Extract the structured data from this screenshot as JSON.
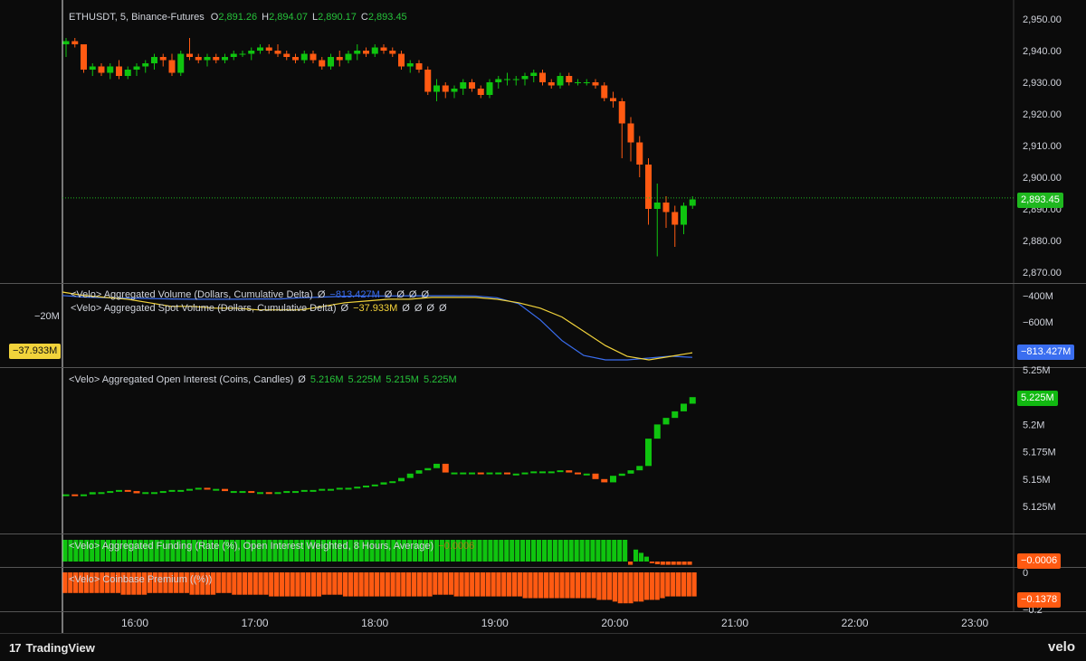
{
  "header": {
    "symbol": "ETHUSDT, 5, Binance-Futures",
    "o_label": "O",
    "o_value": "2,891.26",
    "h_label": "H",
    "h_value": "2,894.07",
    "l_label": "L",
    "l_value": "2,890.17",
    "c_label": "C",
    "c_value": "2,893.45"
  },
  "price_pane": {
    "ticks": [
      "2,950.00",
      "2,940.00",
      "2,930.00",
      "2,920.00",
      "2,910.00",
      "2,900.00",
      "2,890.00",
      "2,880.00",
      "2,870.00"
    ],
    "last_price_label": "2,893.45",
    "last_price": 2893.45
  },
  "volume_pane": {
    "legend1_name": "<Velo> Aggregated Volume (Dollars, Cumulative Delta)",
    "legend1_values": [
      "Ø",
      "−813.427M",
      "Ø",
      "Ø",
      "Ø",
      "Ø"
    ],
    "legend2_name": "<Velo> Aggregated Spot Volume (Dollars, Cumulative Delta)",
    "legend2_values": [
      "Ø",
      "−37.933M",
      "Ø",
      "Ø",
      "Ø",
      "Ø"
    ],
    "right_ticks": [
      "−400M",
      "−600M"
    ],
    "left_tick": "−20M",
    "left_tag": "−37.933M",
    "right_tag": "−813.427M"
  },
  "oi_pane": {
    "legend_name": "<Velo> Aggregated Open Interest (Coins, Candles)",
    "legend_values": [
      "Ø",
      "5.216M",
      "5.225M",
      "5.215M",
      "5.225M"
    ],
    "ticks": [
      "5.25M",
      "5.2M",
      "5.175M",
      "5.15M",
      "5.125M"
    ],
    "last_tag": "5.225M"
  },
  "funding_pane": {
    "legend_name": "<Velo> Aggregated Funding (Rate (%), Open Interest Weighted, 8 Hours, Average)",
    "legend_value": "−0.0006",
    "last_tag": "−0.0006"
  },
  "premium_pane": {
    "legend_name": "<Velo> Coinbase Premium ((%))",
    "ticks": [
      "0",
      "−0.2"
    ],
    "last_tag": "−0.1378"
  },
  "time_axis": [
    "16:00",
    "17:00",
    "18:00",
    "19:00",
    "20:00",
    "21:00",
    "22:00",
    "23:00"
  ],
  "footer": {
    "brand": "TradingView",
    "velo": "velo"
  },
  "colors": {
    "up": "#0fc40f",
    "down": "#ff5a12",
    "spot": "#f2d33b",
    "perp": "#3a6ef0",
    "bg": "#0b0b0b",
    "grid": "#2a2a2a",
    "last_price_tag": "#1fb81f"
  },
  "chart_data": [
    {
      "type": "candlestick",
      "title": "ETHUSDT, 5, Binance-Futures",
      "x": "5-minute candles from about 15:30 to 20:40",
      "ylim": [
        2865,
        2955
      ],
      "ohlc": [
        [
          2942,
          2944,
          2938,
          2943
        ],
        [
          2943,
          2944,
          2941,
          2942
        ],
        [
          2942,
          2942,
          2933,
          2934
        ],
        [
          2934,
          2936,
          2932,
          2935
        ],
        [
          2935,
          2936,
          2932,
          2933
        ],
        [
          2933,
          2936,
          2931,
          2935
        ],
        [
          2935,
          2937,
          2931,
          2932
        ],
        [
          2932,
          2935,
          2931,
          2934
        ],
        [
          2934,
          2936,
          2932,
          2935
        ],
        [
          2935,
          2937,
          2933,
          2936
        ],
        [
          2936,
          2939,
          2934,
          2938
        ],
        [
          2938,
          2939,
          2935,
          2937
        ],
        [
          2937,
          2939,
          2932,
          2933
        ],
        [
          2933,
          2940,
          2932,
          2939
        ],
        [
          2939,
          2944,
          2937,
          2938
        ],
        [
          2938,
          2939,
          2936,
          2937
        ],
        [
          2937,
          2939,
          2935,
          2938
        ],
        [
          2938,
          2939,
          2936,
          2937
        ],
        [
          2937,
          2939,
          2936,
          2938
        ],
        [
          2938,
          2940,
          2937,
          2939
        ],
        [
          2939,
          2940,
          2938,
          2939
        ],
        [
          2939,
          2941,
          2937,
          2940
        ],
        [
          2940,
          2942,
          2939,
          2941
        ],
        [
          2941,
          2942,
          2939,
          2940
        ],
        [
          2940,
          2942,
          2938,
          2939
        ],
        [
          2939,
          2940,
          2937,
          2938
        ],
        [
          2938,
          2939,
          2936,
          2937
        ],
        [
          2937,
          2940,
          2936,
          2939
        ],
        [
          2939,
          2940,
          2936,
          2937
        ],
        [
          2937,
          2938,
          2934,
          2935
        ],
        [
          2935,
          2939,
          2934,
          2938
        ],
        [
          2938,
          2940,
          2935,
          2937
        ],
        [
          2937,
          2940,
          2936,
          2939
        ],
        [
          2939,
          2942,
          2937,
          2940
        ],
        [
          2940,
          2941,
          2938,
          2939
        ],
        [
          2939,
          2942,
          2938,
          2941
        ],
        [
          2941,
          2942,
          2939,
          2940
        ],
        [
          2940,
          2941,
          2938,
          2939
        ],
        [
          2939,
          2940,
          2934,
          2935
        ],
        [
          2935,
          2937,
          2933,
          2936
        ],
        [
          2936,
          2937,
          2933,
          2934
        ],
        [
          2934,
          2935,
          2926,
          2927
        ],
        [
          2927,
          2931,
          2924,
          2929
        ],
        [
          2929,
          2930,
          2925,
          2927
        ],
        [
          2927,
          2929,
          2925,
          2928
        ],
        [
          2928,
          2931,
          2926,
          2930
        ],
        [
          2930,
          2931,
          2927,
          2928
        ],
        [
          2928,
          2929,
          2925,
          2926
        ],
        [
          2926,
          2931,
          2925,
          2930
        ],
        [
          2930,
          2932,
          2928,
          2931
        ],
        [
          2931,
          2933,
          2929,
          2931
        ],
        [
          2931,
          2932,
          2929,
          2931
        ],
        [
          2931,
          2933,
          2929,
          2932
        ],
        [
          2932,
          2934,
          2930,
          2933
        ],
        [
          2933,
          2934,
          2929,
          2930
        ],
        [
          2930,
          2931,
          2928,
          2929
        ],
        [
          2929,
          2933,
          2928,
          2932
        ],
        [
          2932,
          2933,
          2929,
          2930
        ],
        [
          2930,
          2931,
          2929,
          2930
        ],
        [
          2930,
          2931,
          2929,
          2930
        ],
        [
          2930,
          2931,
          2928,
          2929
        ],
        [
          2929,
          2930,
          2924,
          2925
        ],
        [
          2925,
          2927,
          2922,
          2924
        ],
        [
          2924,
          2925,
          2906,
          2917
        ],
        [
          2917,
          2919,
          2905,
          2911
        ],
        [
          2911,
          2913,
          2900,
          2904
        ],
        [
          2904,
          2906,
          2885,
          2890
        ],
        [
          2890,
          2898,
          2875,
          2892
        ],
        [
          2892,
          2894,
          2884,
          2889
        ],
        [
          2889,
          2891,
          2878,
          2885
        ],
        [
          2885,
          2892,
          2882,
          2891
        ],
        [
          2891,
          2894,
          2890,
          2893
        ]
      ]
    },
    {
      "type": "line",
      "title": "<Velo> Aggregated Volume (Dollars, Cumulative Delta)",
      "series": [
        {
          "name": "<Velo> Aggregated Spot Volume (Dollars, Cumulative Delta)",
          "values": [
            0,
            -2,
            -3,
            -4,
            -6,
            -8,
            -8,
            -9,
            -9,
            -10,
            -10,
            -10,
            -8,
            -6,
            -5,
            -4,
            -4,
            -3,
            -3,
            -3,
            -4,
            -6,
            -9,
            -14,
            -22,
            -30,
            -36,
            -38,
            -36,
            -34
          ]
        },
        {
          "name": "<Velo> Aggregated Volume (Dollars, Cumulative Delta)",
          "values": [
            -395,
            -405,
            -410,
            -412,
            -415,
            -418,
            -420,
            -420,
            -420,
            -418,
            -418,
            -410,
            -405,
            -400,
            -398,
            -398,
            -397,
            -397,
            -397,
            -398,
            -410,
            -450,
            -560,
            -700,
            -800,
            -830,
            -830,
            -818,
            -805,
            -813
          ]
        }
      ],
      "ylabel_ticks": [
        "−400M",
        "−600M"
      ]
    },
    {
      "type": "candlestick",
      "title": "<Velo> Aggregated Open Interest (Coins, Candles)",
      "ylim": [
        5.115,
        5.255
      ],
      "values": [
        5.136,
        5.135,
        5.136,
        5.138,
        5.138,
        5.139,
        5.14,
        5.139,
        5.137,
        5.138,
        5.138,
        5.139,
        5.14,
        5.14,
        5.141,
        5.142,
        5.141,
        5.141,
        5.139,
        5.139,
        5.139,
        5.138,
        5.138,
        5.137,
        5.138,
        5.139,
        5.139,
        5.14,
        5.14,
        5.141,
        5.141,
        5.142,
        5.142,
        5.143,
        5.144,
        5.145,
        5.147,
        5.148,
        5.151,
        5.155,
        5.158,
        5.16,
        5.164,
        5.156,
        5.156,
        5.156,
        5.156,
        5.155,
        5.156,
        5.156,
        5.155,
        5.155,
        5.156,
        5.157,
        5.157,
        5.157,
        5.158,
        5.156,
        5.155,
        5.155,
        5.15,
        5.147,
        5.153,
        5.155,
        5.158,
        5.162,
        5.187,
        5.2,
        5.206,
        5.212,
        5.219,
        5.225
      ]
    },
    {
      "type": "bar",
      "title": "<Velo> Aggregated Funding (Rate (%), Open Interest Weighted, 8 Hours, Average)",
      "values": [
        0.004,
        0.004,
        0.004,
        0.004,
        0.004,
        0.004,
        0.004,
        0.004,
        0.004,
        0.004,
        0.004,
        0.004,
        0.004,
        0.004,
        0.004,
        0.004,
        0.004,
        0.004,
        0.004,
        0.004,
        0.004,
        0.004,
        0.004,
        0.004,
        0.004,
        0.004,
        0.004,
        0.004,
        0.004,
        0.004,
        0.004,
        0.004,
        0.004,
        0.004,
        0.004,
        0.004,
        0.004,
        0.004,
        0.004,
        0.004,
        0.004,
        0.004,
        0.004,
        0.004,
        0.004,
        0.004,
        0.004,
        0.004,
        0.004,
        0.004,
        0.004,
        0.004,
        0.004,
        0.004,
        0.004,
        0.004,
        0.004,
        0.004,
        0.004,
        0.004,
        0.004,
        0.004,
        0.004,
        0.004,
        0.004,
        0.004,
        0.004,
        0.004,
        0.004,
        0.004,
        0.004,
        0.004,
        0.004,
        0.004,
        0.004,
        0.004,
        0.004,
        0.004,
        0.004,
        0.004,
        0.004,
        0.004,
        0.004,
        0.004,
        0.004,
        0.004,
        0.004,
        0.004,
        0.004,
        0.004,
        0.004,
        0.004,
        0.004,
        0.004,
        0.004,
        0.004,
        0.004,
        0.004,
        0.004,
        0.004,
        0.004,
        0.004,
        0.004,
        0.004,
        0.004,
        -0.0006,
        0.0022,
        0.0016,
        0.0009,
        -0.0003,
        -0.0005,
        -0.0006,
        -0.0006,
        -0.0006,
        -0.0006,
        -0.0006,
        -0.0006
      ]
    },
    {
      "type": "bar",
      "title": "<Velo> Coinbase Premium ((%))",
      "ylim": [
        -0.2,
        0
      ],
      "values": [
        -0.12,
        -0.12,
        -0.12,
        -0.12,
        -0.12,
        -0.12,
        -0.12,
        -0.12,
        -0.12,
        -0.12,
        -0.12,
        -0.13,
        -0.13,
        -0.13,
        -0.13,
        -0.13,
        -0.12,
        -0.12,
        -0.12,
        -0.12,
        -0.12,
        -0.12,
        -0.12,
        -0.12,
        -0.13,
        -0.13,
        -0.13,
        -0.13,
        -0.13,
        -0.12,
        -0.12,
        -0.12,
        -0.13,
        -0.13,
        -0.13,
        -0.13,
        -0.13,
        -0.13,
        -0.13,
        -0.14,
        -0.14,
        -0.14,
        -0.14,
        -0.14,
        -0.14,
        -0.14,
        -0.14,
        -0.14,
        -0.14,
        -0.13,
        -0.13,
        -0.13,
        -0.13,
        -0.14,
        -0.14,
        -0.14,
        -0.14,
        -0.14,
        -0.14,
        -0.14,
        -0.14,
        -0.14,
        -0.14,
        -0.14,
        -0.14,
        -0.14,
        -0.14,
        -0.14,
        -0.14,
        -0.14,
        -0.13,
        -0.13,
        -0.13,
        -0.13,
        -0.14,
        -0.14,
        -0.14,
        -0.14,
        -0.14,
        -0.14,
        -0.14,
        -0.14,
        -0.14,
        -0.14,
        -0.14,
        -0.14,
        -0.14,
        -0.15,
        -0.15,
        -0.15,
        -0.15,
        -0.15,
        -0.15,
        -0.15,
        -0.15,
        -0.15,
        -0.15,
        -0.15,
        -0.15,
        -0.15,
        -0.15,
        -0.16,
        -0.16,
        -0.16,
        -0.17,
        -0.18,
        -0.18,
        -0.18,
        -0.17,
        -0.17,
        -0.16,
        -0.16,
        -0.16,
        -0.15,
        -0.14,
        -0.14,
        -0.14,
        -0.14,
        -0.14,
        -0.14
      ]
    }
  ]
}
